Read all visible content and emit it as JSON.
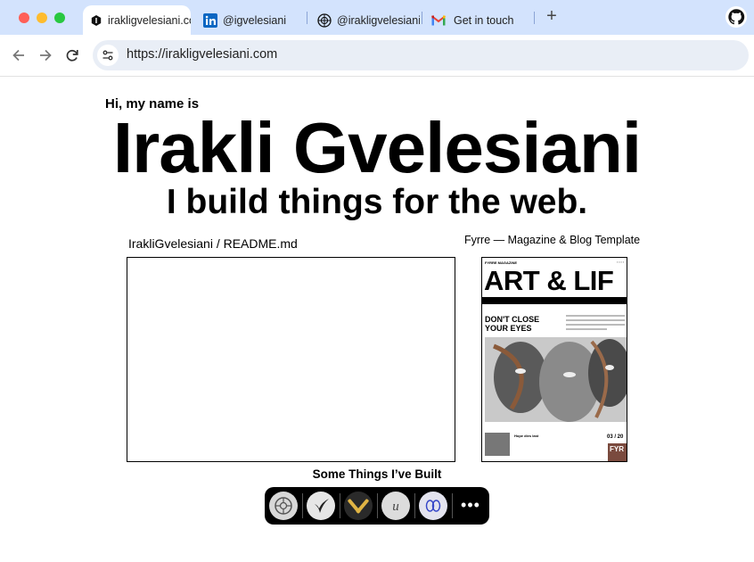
{
  "browser": {
    "tabs": [
      {
        "label": "irakligvelesiani.com",
        "icon": "site-favicon"
      },
      {
        "label": "@igvelesiani",
        "icon": "linkedin-icon"
      },
      {
        "label": "@irakligvelesiani",
        "icon": "threads-icon"
      },
      {
        "label": "Get in touch",
        "icon": "gmail-icon"
      }
    ],
    "new_tab_label": "+",
    "url": "https://irakligvelesiani.com"
  },
  "hero": {
    "greeting": "Hi, my name is",
    "name": "Irakli Gvelesiani",
    "tagline": "I build things for the web."
  },
  "projects": {
    "readme_caption": "IrakliGvelesiani / README.md",
    "template_caption": "Fyrre — Magazine & Blog Template",
    "preview": {
      "masthead": "FYRRE MAGAZINE",
      "headline": "ART & LIF",
      "subhead": "DON'T CLOSE YOUR EYES",
      "story": "Hope dies last",
      "date": "03 / 20",
      "logo": "FYR"
    },
    "section_title": "Some Things I’ve Built",
    "dock_items": [
      "project-1-icon",
      "project-2-icon",
      "project-3-icon",
      "project-4-icon",
      "project-5-icon"
    ],
    "more_label": "•••"
  }
}
